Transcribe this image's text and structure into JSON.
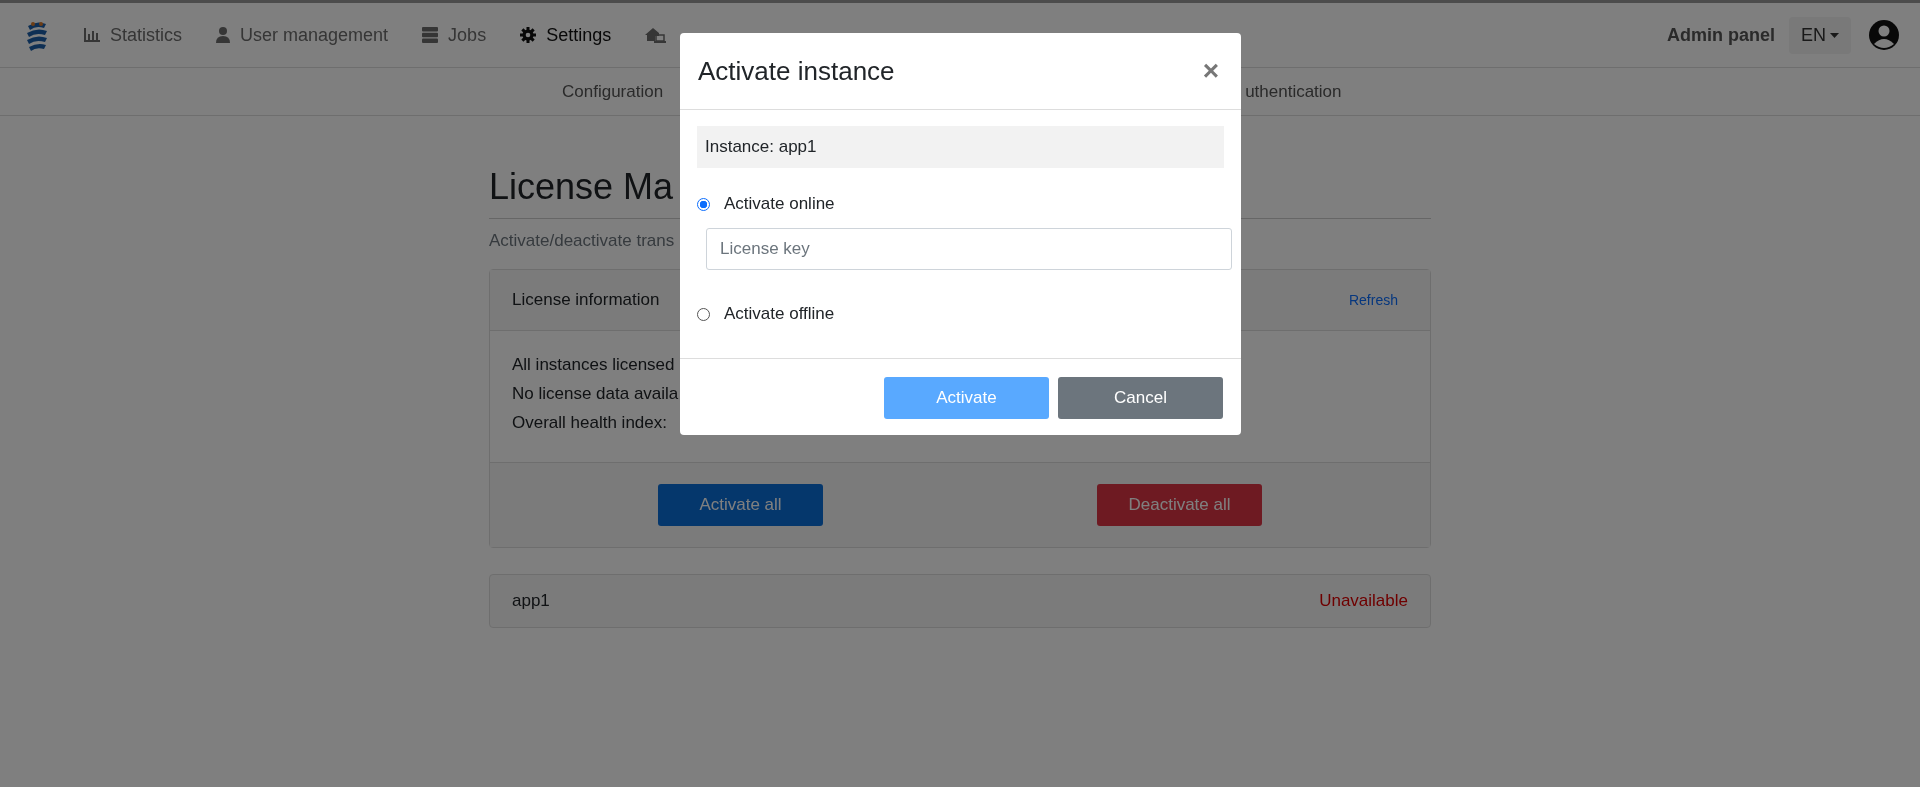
{
  "navbar": {
    "items": [
      {
        "label": "Statistics",
        "selected": false
      },
      {
        "label": "User management",
        "selected": false
      },
      {
        "label": "Jobs",
        "selected": false
      },
      {
        "label": "Settings",
        "selected": true
      },
      {
        "selected": false
      }
    ],
    "admin_label": "Admin panel",
    "language": "EN"
  },
  "subnav": {
    "tabs": [
      {
        "label": "Configuration"
      },
      {
        "label": "uthentication"
      }
    ]
  },
  "page": {
    "title": "License Ma",
    "subtitle": "Activate/deactivate trans",
    "card": {
      "header": "License information",
      "refresh": "Refresh",
      "lines": [
        "All instances licensed",
        "No license data availa",
        "Overall health index:"
      ],
      "buttons": [
        {
          "label": "Activate all",
          "kind": "primary"
        },
        {
          "label": "Deactivate all",
          "kind": "danger"
        }
      ]
    },
    "instances": [
      {
        "name": "app1",
        "status": "Unavailable"
      }
    ]
  },
  "modal": {
    "title": "Activate instance",
    "close": "×",
    "instance": "Instance: app1",
    "options": [
      {
        "label": "Activate online",
        "selected": true
      },
      {
        "label": "Activate offline",
        "selected": false
      }
    ],
    "license_field": {
      "placeholder": "License key"
    },
    "buttons": [
      {
        "label": "Activate",
        "kind": "primary",
        "disabled": true
      },
      {
        "label": "Cancel",
        "kind": "secondary",
        "disabled": false
      }
    ]
  }
}
